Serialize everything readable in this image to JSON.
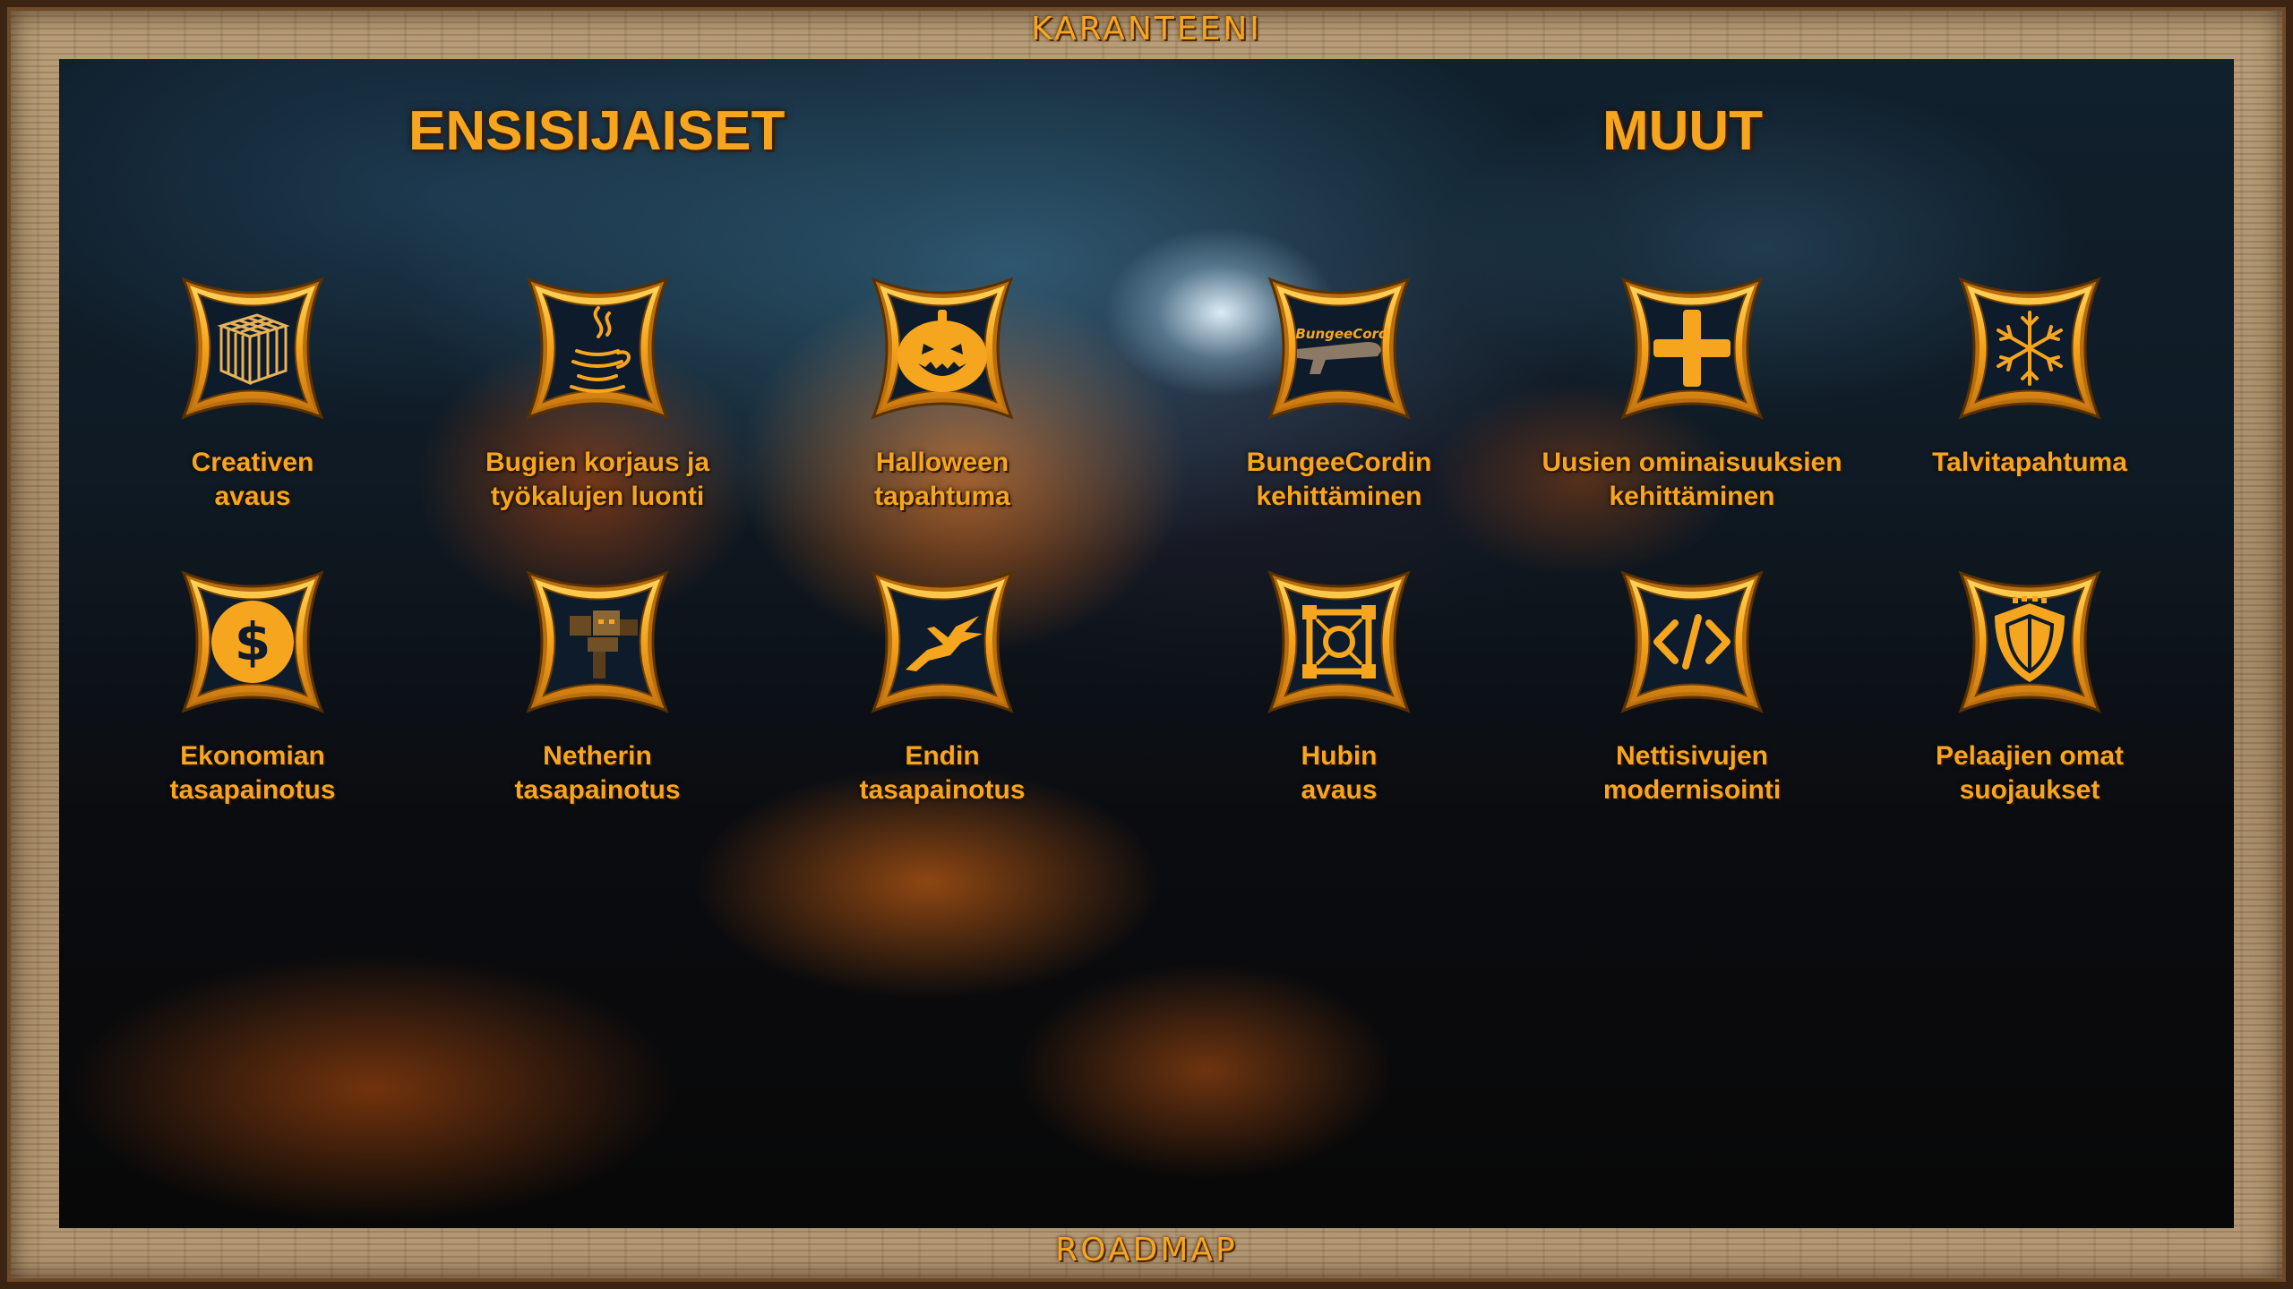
{
  "frame": {
    "top_title": "KARANTEENI",
    "bottom_title": "ROADMAP"
  },
  "sections": {
    "primary": "ENSISIJAISET",
    "other": "MUUT"
  },
  "items": [
    {
      "icon": "creative-block-icon",
      "line1": "Creativen",
      "line2": "avaus"
    },
    {
      "icon": "java-cup-icon",
      "line1": "Bugien korjaus ja",
      "line2": "työkalujen luonti"
    },
    {
      "icon": "pumpkin-icon",
      "line1": "Halloween",
      "line2": "tapahtuma"
    },
    {
      "icon": "bungeecord-icon",
      "icon_text": "BungeeCord",
      "line1": "BungeeCordin",
      "line2": "kehittäminen"
    },
    {
      "icon": "plus-icon",
      "line1": "Uusien ominaisuuksien",
      "line2": "kehittäminen"
    },
    {
      "icon": "snowflake-icon",
      "line1": "Talvitapahtuma",
      "line2": ""
    },
    {
      "icon": "dollar-coin-icon",
      "line1": "Ekonomian",
      "line2": "tasapainotus"
    },
    {
      "icon": "wither-icon",
      "line1": "Netherin",
      "line2": "tasapainotus"
    },
    {
      "icon": "ender-dragon-icon",
      "line1": "Endin",
      "line2": "tasapainotus"
    },
    {
      "icon": "hub-frame-icon",
      "line1": "Hubin",
      "line2": "avaus"
    },
    {
      "icon": "code-icon",
      "line1": "Nettisivujen",
      "line2": "modernisointi"
    },
    {
      "icon": "shield-icon",
      "line1": "Pelaajien omat",
      "line2": "suojaukset"
    }
  ],
  "colors": {
    "accent": "#f6a51f",
    "badge_fill": "#0d1b2a",
    "frame_wood": "#a98d68"
  }
}
